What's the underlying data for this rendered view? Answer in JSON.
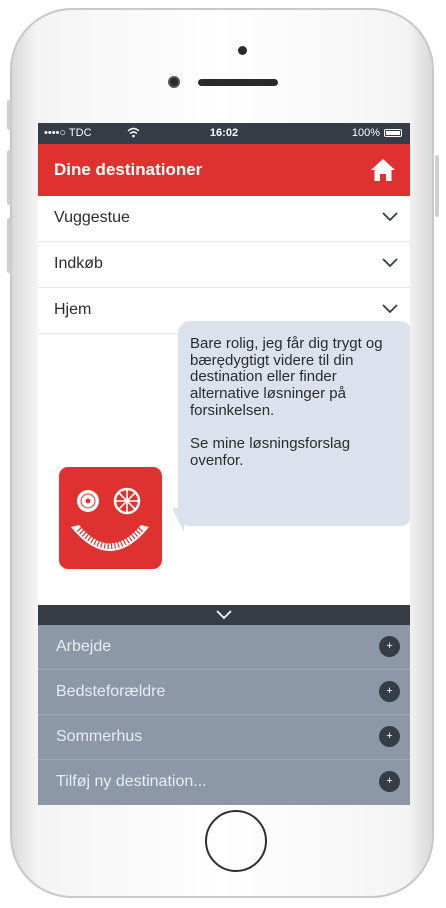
{
  "status_bar": {
    "carrier": "••••○ TDC",
    "time": "16:02",
    "battery": "100%"
  },
  "header": {
    "title": "Dine destinationer",
    "home_icon": "home-icon"
  },
  "destinations": [
    {
      "label": "Vuggestue"
    },
    {
      "label": "Indkøb"
    },
    {
      "label": "Hjem"
    }
  ],
  "assistant": {
    "message": "Bare rolig, jeg får dig trygt og bærędygtigt videre til din destination eller finder alternative løsninger på forsinkelsen.\n\nSe mine løsningsforslag ovenfor."
  },
  "suggestions": [
    {
      "label": "Arbejde"
    },
    {
      "label": "Bedsteforældre"
    },
    {
      "label": "Sommerhus"
    },
    {
      "label": "Tilføj ny destination..."
    }
  ],
  "colors": {
    "accent": "#e03131",
    "dark": "#353c45",
    "panel": "#8c98a8",
    "bubble": "#dce2ed"
  }
}
